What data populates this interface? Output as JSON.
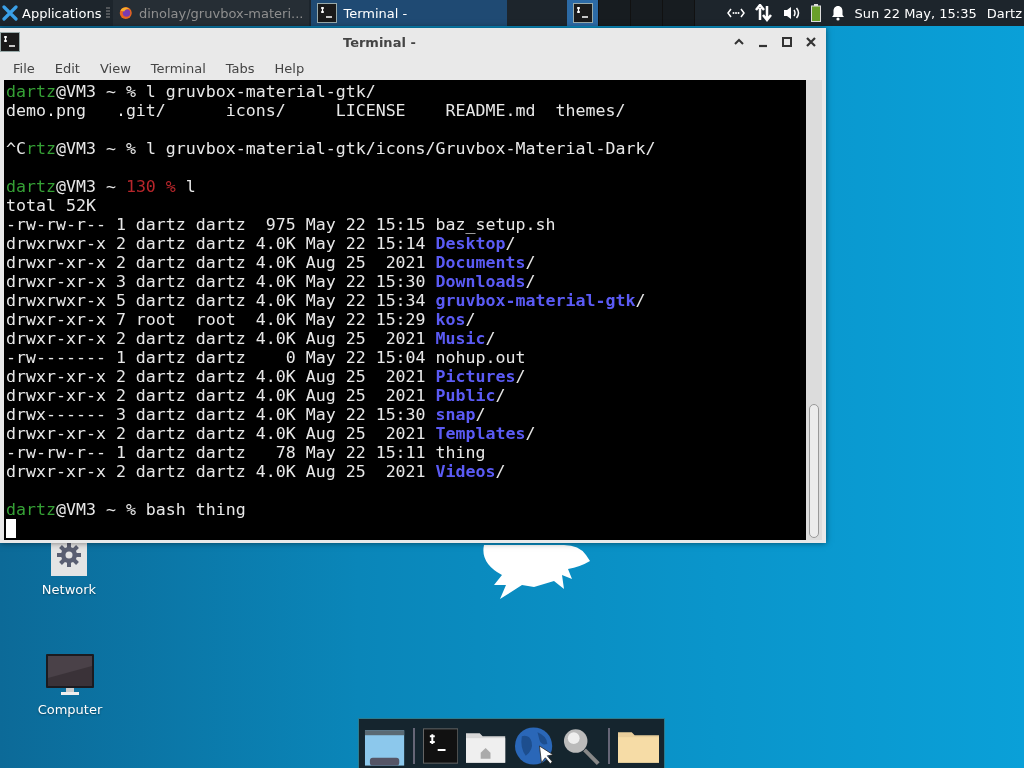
{
  "panel": {
    "applications_label": "Applications",
    "tasks": [
      {
        "label": "dinolay/gruvbox-materi...",
        "kind": "browser",
        "selected": false
      },
      {
        "label": "Terminal -",
        "kind": "terminal",
        "selected": true
      }
    ],
    "workspaces": [
      {
        "selected": true,
        "kind": "terminal"
      },
      {
        "selected": false,
        "kind": "empty"
      },
      {
        "selected": false,
        "kind": "empty"
      },
      {
        "selected": false,
        "kind": "empty"
      }
    ],
    "clock": "Sun 22 May, 15:35",
    "user": "Dartz"
  },
  "window": {
    "title": "Terminal -",
    "menu": [
      "File",
      "Edit",
      "View",
      "Terminal",
      "Tabs",
      "Help"
    ],
    "lines": [
      {
        "segments": [
          {
            "text": "dartz",
            "kind": "user"
          },
          {
            "text": "@VM3 ~ % l gruvbox-material-gtk/",
            "kind": "plain"
          }
        ]
      },
      {
        "segments": [
          {
            "text": "demo.png   .git/      icons/     LICENSE    README.md  themes/",
            "kind": "plain"
          }
        ]
      },
      {
        "kind": "blank"
      },
      {
        "segments": [
          {
            "text": "^C",
            "kind": "plain"
          },
          {
            "text": "rtz",
            "kind": "user"
          },
          {
            "text": "@VM3 ~ % l gruvbox-material-gtk/icons/Gruvbox-Material-Dark/",
            "kind": "plain"
          }
        ]
      },
      {
        "kind": "blank"
      },
      {
        "segments": [
          {
            "text": "dartz",
            "kind": "user"
          },
          {
            "text": "@VM3 ~ ",
            "kind": "plain"
          },
          {
            "text": "130 %",
            "kind": "error"
          },
          {
            "text": " l",
            "kind": "plain"
          }
        ]
      },
      {
        "segments": [
          {
            "text": "total 52K",
            "kind": "plain"
          }
        ]
      },
      {
        "segments": [
          {
            "text": "-rw-rw-r-- 1 dartz dartz  975 May 22 15:15 baz_setup.sh",
            "kind": "plain"
          }
        ]
      },
      {
        "segments": [
          {
            "text": "drwxrwxr-x 2 dartz dartz 4.0K May 22 15:14 ",
            "kind": "plain"
          },
          {
            "text": "Desktop",
            "kind": "dir"
          },
          {
            "text": "/",
            "kind": "plain"
          }
        ]
      },
      {
        "segments": [
          {
            "text": "drwxr-xr-x 2 dartz dartz 4.0K Aug 25  2021 ",
            "kind": "plain"
          },
          {
            "text": "Documents",
            "kind": "dir"
          },
          {
            "text": "/",
            "kind": "plain"
          }
        ]
      },
      {
        "segments": [
          {
            "text": "drwxr-xr-x 3 dartz dartz 4.0K May 22 15:30 ",
            "kind": "plain"
          },
          {
            "text": "Downloads",
            "kind": "dir"
          },
          {
            "text": "/",
            "kind": "plain"
          }
        ]
      },
      {
        "segments": [
          {
            "text": "drwxrwxr-x 5 dartz dartz 4.0K May 22 15:34 ",
            "kind": "plain"
          },
          {
            "text": "gruvbox-material-gtk",
            "kind": "dir"
          },
          {
            "text": "/",
            "kind": "plain"
          }
        ]
      },
      {
        "segments": [
          {
            "text": "drwxr-xr-x 7 root  root  4.0K May 22 15:29 ",
            "kind": "plain"
          },
          {
            "text": "kos",
            "kind": "dir"
          },
          {
            "text": "/",
            "kind": "plain"
          }
        ]
      },
      {
        "segments": [
          {
            "text": "drwxr-xr-x 2 dartz dartz 4.0K Aug 25  2021 ",
            "kind": "plain"
          },
          {
            "text": "Music",
            "kind": "dir"
          },
          {
            "text": "/",
            "kind": "plain"
          }
        ]
      },
      {
        "segments": [
          {
            "text": "-rw------- 1 dartz dartz    0 May 22 15:04 nohup.out",
            "kind": "plain"
          }
        ]
      },
      {
        "segments": [
          {
            "text": "drwxr-xr-x 2 dartz dartz 4.0K Aug 25  2021 ",
            "kind": "plain"
          },
          {
            "text": "Pictures",
            "kind": "dir"
          },
          {
            "text": "/",
            "kind": "plain"
          }
        ]
      },
      {
        "segments": [
          {
            "text": "drwxr-xr-x 2 dartz dartz 4.0K Aug 25  2021 ",
            "kind": "plain"
          },
          {
            "text": "Public",
            "kind": "dir"
          },
          {
            "text": "/",
            "kind": "plain"
          }
        ]
      },
      {
        "segments": [
          {
            "text": "drwx------ 3 dartz dartz 4.0K May 22 15:30 ",
            "kind": "plain"
          },
          {
            "text": "snap",
            "kind": "dir"
          },
          {
            "text": "/",
            "kind": "plain"
          }
        ]
      },
      {
        "segments": [
          {
            "text": "drwxr-xr-x 2 dartz dartz 4.0K Aug 25  2021 ",
            "kind": "plain"
          },
          {
            "text": "Templates",
            "kind": "dir"
          },
          {
            "text": "/",
            "kind": "plain"
          }
        ]
      },
      {
        "segments": [
          {
            "text": "-rw-rw-r-- 1 dartz dartz   78 May 22 15:11 thing",
            "kind": "plain"
          }
        ]
      },
      {
        "segments": [
          {
            "text": "drwxr-xr-x 2 dartz dartz 4.0K Aug 25  2021 ",
            "kind": "plain"
          },
          {
            "text": "Videos",
            "kind": "dir"
          },
          {
            "text": "/",
            "kind": "plain"
          }
        ]
      },
      {
        "kind": "blank"
      },
      {
        "segments": [
          {
            "text": "dartz",
            "kind": "user"
          },
          {
            "text": "@VM3 ~ % bash thing",
            "kind": "plain"
          }
        ]
      }
    ],
    "cursor": true
  },
  "desktop_icons": [
    {
      "label": "Network",
      "kind": "network"
    },
    {
      "label": "Computer",
      "kind": "computer"
    }
  ]
}
